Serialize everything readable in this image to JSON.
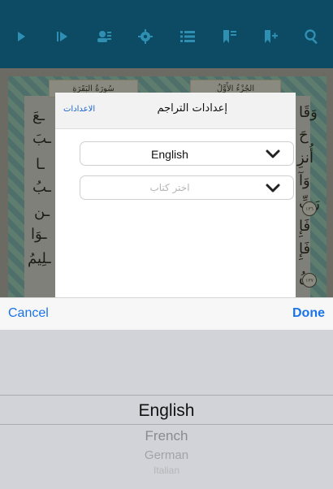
{
  "toolbar": {
    "icons": [
      "play-icon",
      "fast-forward-icon",
      "reciters-icon",
      "gear-icon",
      "list-icon",
      "bookmark-list-icon",
      "bookmark-add-icon",
      "search-icon"
    ]
  },
  "quran_page": {
    "surah_header": "سُورَةُ البَقَرَةِ",
    "juz_header": "الجُزْءُ الأَوَّلُ",
    "right_edge_fragments": [
      "وَقَا",
      "حَ",
      "أُنزِ",
      "وَآ",
      "رَبِّ",
      "فَإِ",
      "فَإِ",
      "سُ"
    ],
    "left_edge_fragments": [
      "ـعَ",
      "ـبَ",
      "ـا",
      "ـبُ",
      "ـن",
      "ـوَا",
      "ـلِيمُ"
    ],
    "ayah_markers": [
      "١٣٦",
      "١٣٧"
    ]
  },
  "modal": {
    "title": "إعدادات التراجم",
    "link": "الاعدادات",
    "language_select": {
      "value": "English"
    },
    "book_select": {
      "placeholder": "اختر كتاب"
    }
  },
  "picker_toolbar": {
    "cancel": "Cancel",
    "done": "Done"
  },
  "picker": {
    "options": [
      "English",
      "French",
      "German",
      "Italian"
    ],
    "selected": "English"
  },
  "colors": {
    "accent": "#1a73e8",
    "toolbar_bg": "#0d4a63",
    "picker_bg": "#d1d3d8"
  }
}
